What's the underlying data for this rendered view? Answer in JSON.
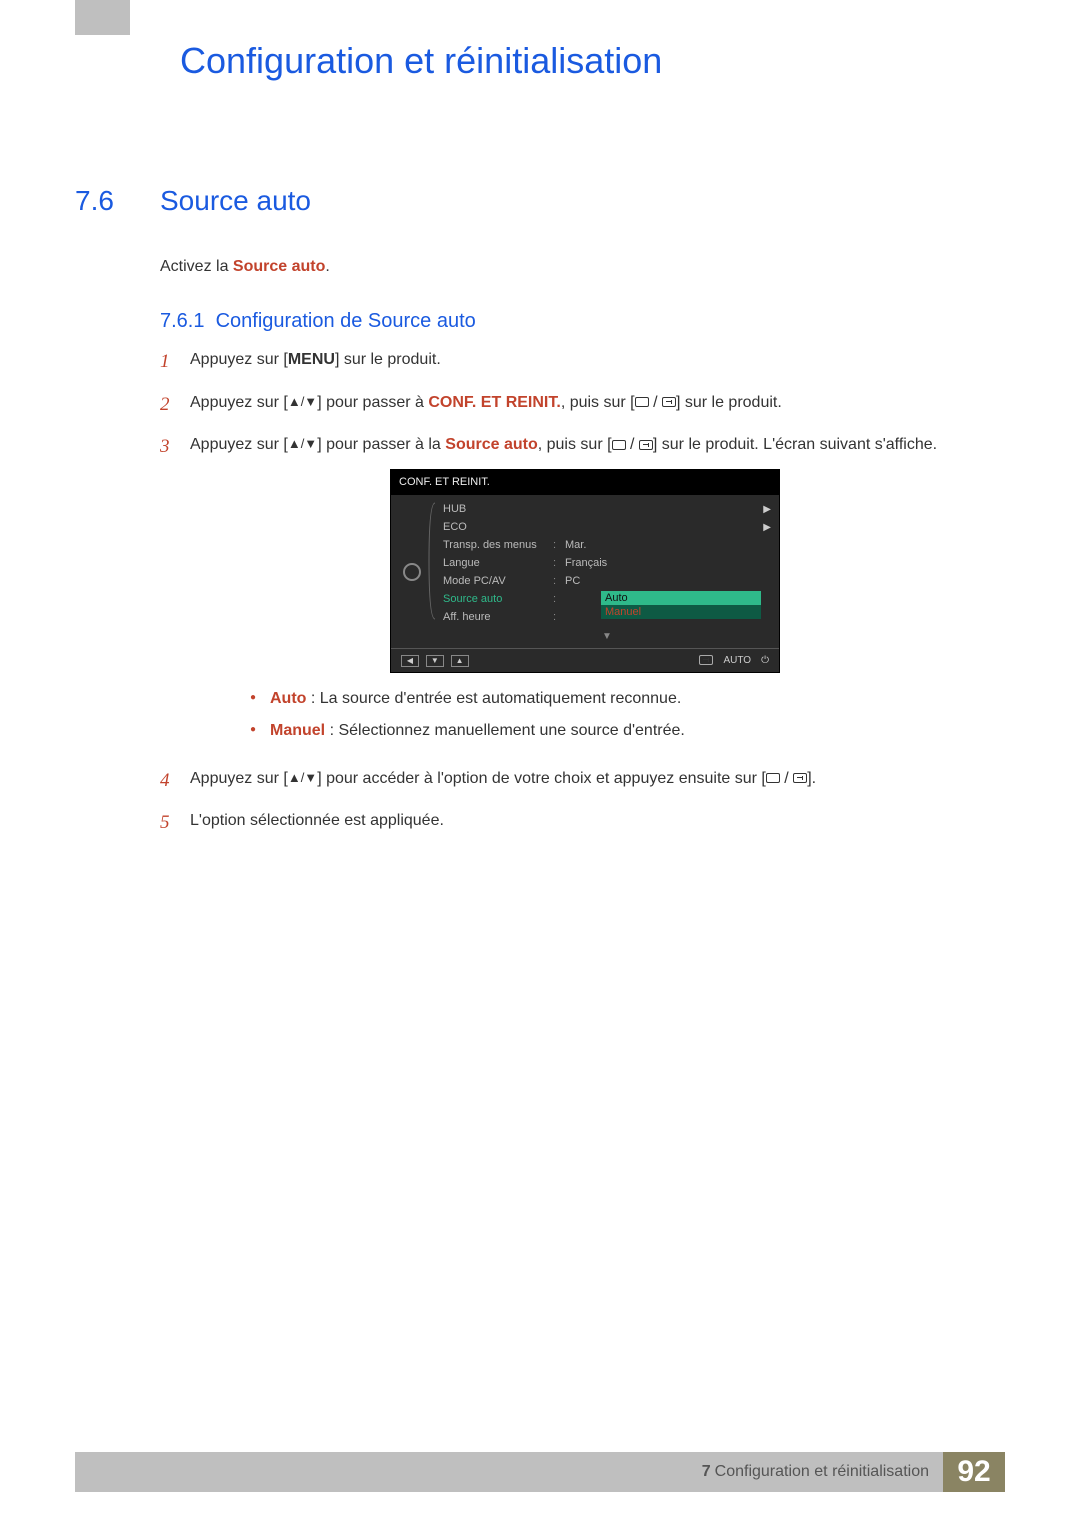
{
  "chapter_title": "Configuration et réinitialisation",
  "section": {
    "number": "7.6",
    "title": "Source auto"
  },
  "intro": {
    "pre": "Activez la ",
    "hl": "Source auto",
    "post": "."
  },
  "subsection": {
    "number": "7.6.1",
    "title": "Configuration de Source auto"
  },
  "steps": {
    "s1": {
      "num": "1",
      "pre": "Appuyez sur [",
      "menu": "MENU",
      "post": "] sur le produit."
    },
    "s2": {
      "num": "2",
      "pre": "Appuyez sur [",
      "mid": "] pour passer à ",
      "hl": "CONF. ET REINIT.",
      "post1": ", puis sur [",
      "post2": "] sur le produit."
    },
    "s3": {
      "num": "3",
      "pre": "Appuyez sur [",
      "mid": "] pour passer à la ",
      "hl": "Source auto",
      "post1": ", puis sur [",
      "post2": "] sur le produit. L'écran suivant s'affiche."
    },
    "s4": {
      "num": "4",
      "pre": "Appuyez sur [",
      "mid": "] pour accéder à l'option de votre choix et appuyez ensuite sur [",
      "post": "]."
    },
    "s5": {
      "num": "5",
      "text": "L'option sélectionnée est appliquée."
    }
  },
  "bullets": {
    "auto": {
      "hl": "Auto",
      "text": " : La source d'entrée est automatiquement reconnue."
    },
    "manuel": {
      "hl": "Manuel",
      "text": " : Sélectionnez manuellement une source d'entrée."
    }
  },
  "osd": {
    "title": "CONF. ET REINIT.",
    "rows": {
      "hub": "HUB",
      "eco": "ECO",
      "transp": {
        "lbl": "Transp. des menus",
        "val": "Mar."
      },
      "langue": {
        "lbl": "Langue",
        "val": "Français"
      },
      "mode": {
        "lbl": "Mode PC/AV",
        "val": "PC"
      },
      "source": {
        "lbl": "Source auto"
      },
      "aff": "Aff. heure"
    },
    "options": {
      "a": "Auto",
      "b": "Manuel"
    },
    "bottom_auto": "AUTO"
  },
  "footer": {
    "chapter_num": "7",
    "chapter_label": "Configuration et réinitialisation",
    "page": "92"
  }
}
